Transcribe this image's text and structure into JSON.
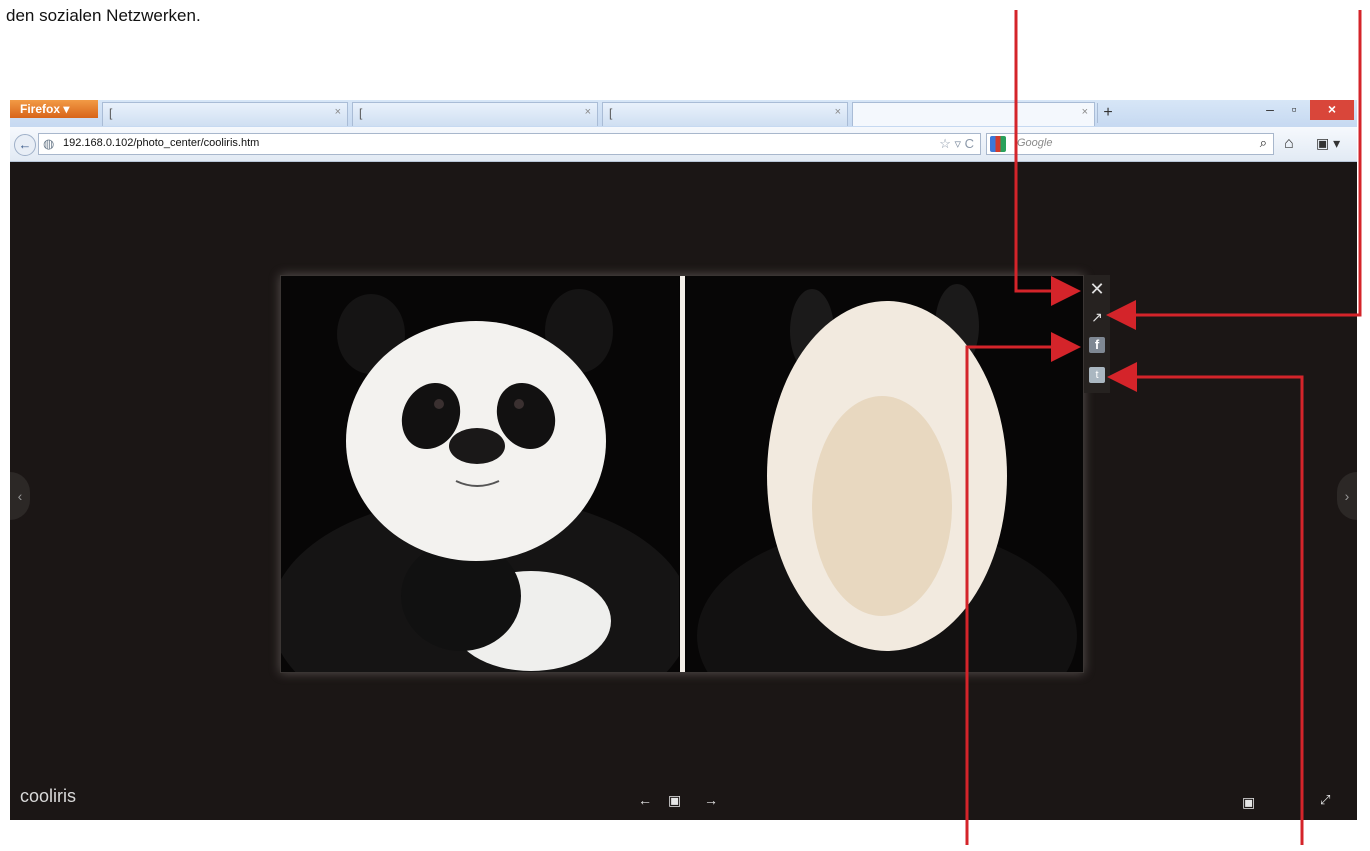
{
  "caption": "den sozialen Netzwerken.",
  "browser": {
    "menu_button": "Firefox ▾",
    "tabs": [
      {
        "label": "[",
        "close": "×"
      },
      {
        "label": "[",
        "close": "×"
      },
      {
        "label": "[",
        "close": "×"
      },
      {
        "label": "",
        "close": "×"
      }
    ],
    "new_tab": "+",
    "window_controls": {
      "minimize": "–",
      "maximize": "▫",
      "close": "×"
    },
    "back": "←",
    "url": "192.168.0.102/photo_center/cooliris.htm",
    "url_tools": "☆ ▿ C",
    "search_placeholder": "Google",
    "search_icon": "⌕",
    "home_icon": "⌂",
    "bookmarks_icon": "▣ ▾"
  },
  "viewer": {
    "prev_side": "‹",
    "next_side": "›",
    "toolbar": {
      "close": "✕",
      "open_external": "↗",
      "facebook": "f",
      "twitter": "t"
    },
    "brand": "cooliris",
    "controls": {
      "prev": "←",
      "slideshow": "▣",
      "next": "→"
    },
    "right_controls": {
      "slideshow": "▣",
      "fullscreen": "⤢"
    }
  },
  "colors": {
    "background": "#1b1615",
    "annotation_arrows": "#d4242a",
    "firefox_button": "#e07a2c",
    "window_close": "#d9463a"
  }
}
